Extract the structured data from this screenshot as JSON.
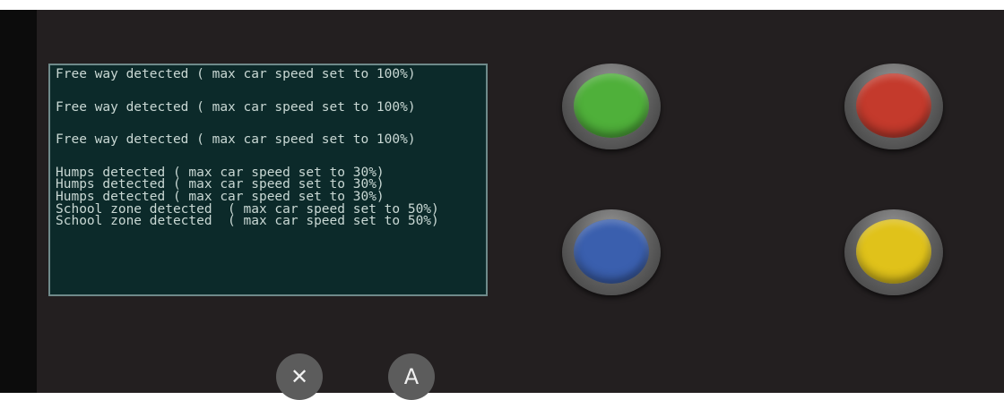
{
  "log": {
    "lines": [
      "Free way detected ( max car speed set to 100%)",
      "Free way detected ( max car speed set to 100%)",
      "Free way detected ( max car speed set to 100%)",
      "Humps detected ( max car speed set to 30%)",
      "Humps detected ( max car speed set to 30%)",
      "Humps detected ( max car speed set to 30%)",
      "School zone detected  ( max car speed set to 50%)",
      "School zone detected  ( max car speed set to 50%)"
    ]
  },
  "buttons": {
    "x_label": "✕",
    "a_label": "A"
  },
  "colors": {
    "green": "#4fb03a",
    "red": "#c43a2c",
    "blue": "#3a5fae",
    "yellow": "#e0c21a"
  }
}
